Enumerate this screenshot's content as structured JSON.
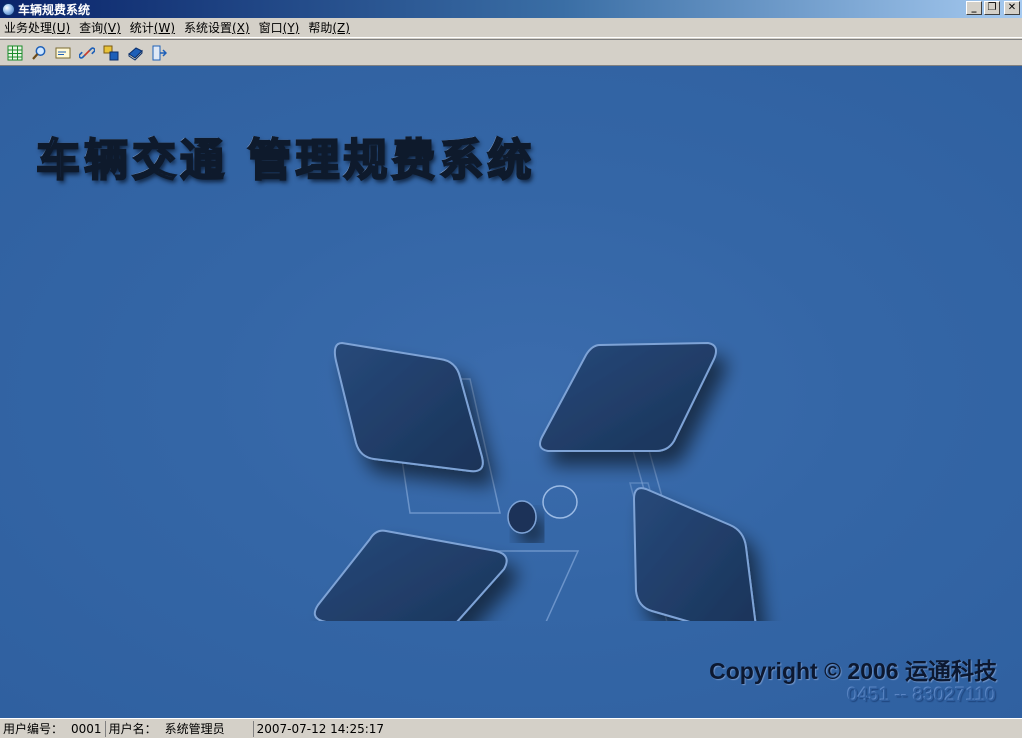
{
  "window": {
    "title": "车辆规费系统",
    "minimize_label": "_",
    "restore_label": "❐",
    "close_label": "✕"
  },
  "menu": [
    {
      "label": "业务处理",
      "key": "(U)"
    },
    {
      "label": "查询",
      "key": "(V)"
    },
    {
      "label": "统计",
      "key": "(W)"
    },
    {
      "label": "系统设置",
      "key": "(X)"
    },
    {
      "label": "窗口",
      "key": "(Y)"
    },
    {
      "label": "帮助",
      "key": "(Z)"
    }
  ],
  "toolbar": {
    "icons": [
      "spreadsheet-icon",
      "search-icon",
      "card-icon",
      "link-icon",
      "windows-icon",
      "book-icon",
      "exit-icon"
    ],
    "colors": {
      "green": "#1a8a2a",
      "blue": "#1d5fb8",
      "yellow": "#e8c33a",
      "red": "#c83a2a"
    }
  },
  "main": {
    "banner_title": "车辆交通 管理规费系统",
    "copyright": "Copyright © 2006 运通科技",
    "phone": "0451 -- 83027110",
    "background_color": "#3466a6",
    "tile_color": "#1f3b63"
  },
  "status": {
    "user_id_label": "用户编号：",
    "user_id_value": "0001",
    "user_name_label": "用户名：",
    "user_name_value": "系统管理员",
    "datetime": "2007-07-12 14:25:17"
  }
}
